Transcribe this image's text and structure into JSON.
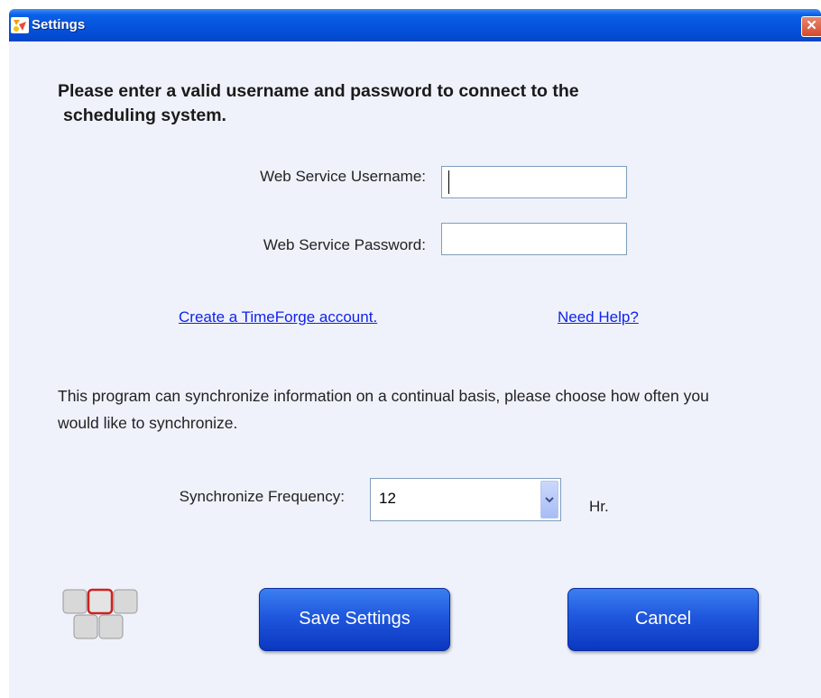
{
  "window": {
    "title": "Settings",
    "close_glyph": "✕",
    "icon": "app-icon"
  },
  "intro": {
    "line1": "Please enter a valid username and password to connect to the",
    "line2": "scheduling system."
  },
  "username": {
    "label": "Web Service Username:",
    "value": ""
  },
  "password": {
    "label": "Web Service Password:",
    "value": ""
  },
  "links": {
    "create_account": "Create a TimeForge account.",
    "help": "Need Help?"
  },
  "sync": {
    "description": "This program can synchronize information on a continual basis, please choose how often you would like to synchronize.",
    "label": "Synchronize Frequency:",
    "value": "12",
    "unit": "Hr."
  },
  "buttons": {
    "save": "Save Settings",
    "cancel": "Cancel"
  },
  "colors": {
    "titlebar": "#0552dc",
    "client_bg": "#eff2fb",
    "button": "#1f57dd",
    "link": "#1122ee"
  }
}
